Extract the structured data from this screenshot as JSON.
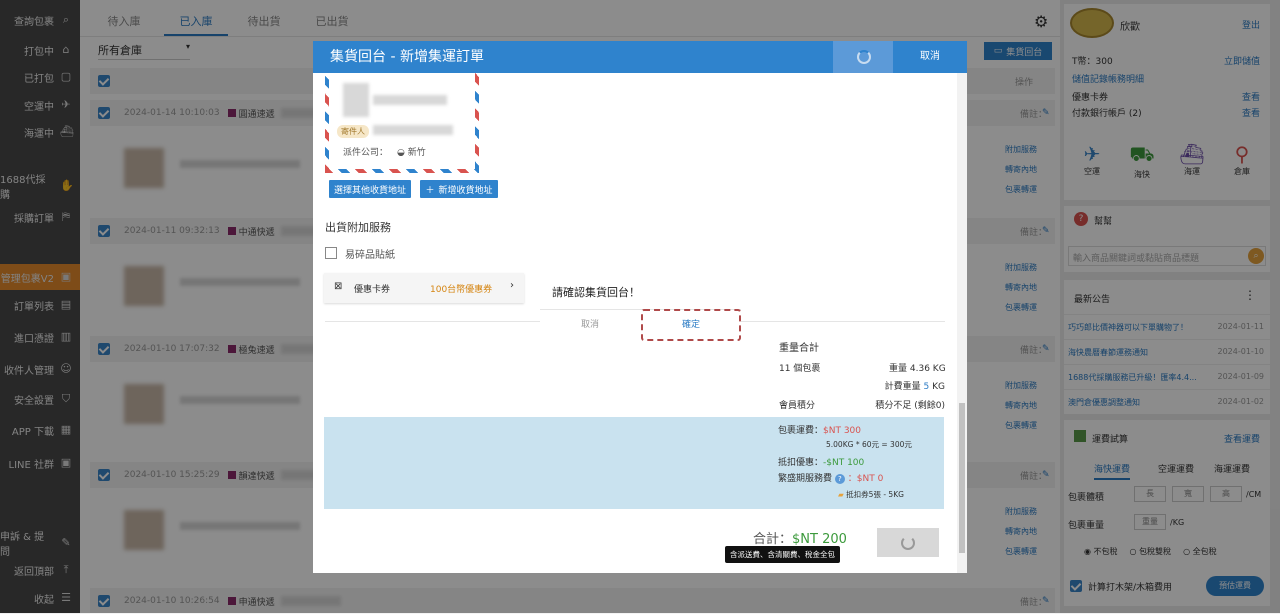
{
  "sidebar": {
    "items": [
      {
        "label": "查詢包裹",
        "icon": "search-icon",
        "glyph": "⌕"
      },
      {
        "label": "打包中",
        "icon": "gift-icon",
        "glyph": "⌂"
      },
      {
        "label": "已打包",
        "icon": "box-icon",
        "glyph": "▢"
      },
      {
        "label": "空運中",
        "icon": "plane-icon",
        "glyph": "✈"
      },
      {
        "label": "海運中",
        "icon": "ship-icon",
        "glyph": "⛴"
      },
      {
        "label": "1688代採購",
        "icon": "hand-icon",
        "glyph": "✋"
      },
      {
        "label": "採購訂單",
        "icon": "basket-icon",
        "glyph": "⛿"
      },
      {
        "label": "管理包裹V2",
        "icon": "box-icon",
        "glyph": "▣"
      },
      {
        "label": "訂單列表",
        "icon": "clipboard-icon",
        "glyph": "▤"
      },
      {
        "label": "進口憑證",
        "icon": "printer-icon",
        "glyph": "▥"
      },
      {
        "label": "收件人管理",
        "icon": "user-icon",
        "glyph": "☺"
      },
      {
        "label": "安全設置",
        "icon": "shield-icon",
        "glyph": "⛉"
      },
      {
        "label": "APP 下載",
        "icon": "bus-icon",
        "glyph": "▦"
      },
      {
        "label": "LINE 社群",
        "icon": "line-icon",
        "glyph": "▣"
      },
      {
        "label": "申訴 & 提問",
        "icon": "edit-icon",
        "glyph": "✎"
      },
      {
        "label": "返回頂部",
        "icon": "arrow-up-icon",
        "glyph": "⤒"
      },
      {
        "label": "收起",
        "icon": "collapse-icon",
        "glyph": "☰"
      }
    ]
  },
  "main": {
    "tabs": [
      "待入庫",
      "已入庫",
      "待出貨",
      "已出貨"
    ],
    "active_tab": 1,
    "warehouse_select": "所有倉庫",
    "consolidate_button": "集貨回台",
    "operation_header": "操作",
    "orders": [
      {
        "time": "2024-01-14 10:10:03",
        "carrier": "圓通速遞",
        "remark": "備註："
      },
      {
        "time": "2024-01-11 09:32:13",
        "carrier": "中通快遞",
        "remark": "備註："
      },
      {
        "time": "2024-01-10 17:07:32",
        "carrier": "極兔速遞",
        "remark": "備註："
      },
      {
        "time": "2024-01-10 15:25:29",
        "carrier": "韻達快遞",
        "remark": "備註："
      },
      {
        "time": "2024-01-10 10:26:54",
        "carrier": "申通快遞",
        "remark": "備註："
      }
    ],
    "order_links": [
      "附加服務",
      "轉寄內地",
      "包裹轉運"
    ]
  },
  "modal": {
    "title": "集貨回台 - 新增集運訂單",
    "cancel_label": "取消",
    "sender_badge": "寄件人",
    "delivery_company_label": "派件公司：",
    "delivery_company_value": "新竹",
    "choose_address_button": "選擇其他收貨地址",
    "add_address_button": "新增收貨地址",
    "extra_service_title": "出貨附加服務",
    "fragile_label": "易碎品貼紙",
    "coupon_label": "優惠卡券",
    "coupon_value": "100台幣優惠券",
    "weight_title": "重量合計",
    "package_count": "11 個包裹",
    "weight_label": "重量",
    "weight_value": "4.36 KG",
    "billing_weight_label": "計費重量",
    "billing_weight_value": "5",
    "billing_weight_unit": "KG",
    "member_points_label": "會員積分",
    "member_points_value": "積分不足 (剩餘0)",
    "shipping_fee_label": "包裹運費：",
    "shipping_fee_value": "$NT 300",
    "shipping_formula": "5.00KG * 60元 = 300元",
    "discount_label": "抵扣優惠：",
    "discount_value": "-$NT 100",
    "surge_fee_label": "繁盛期服務費",
    "surge_fee_value": "：$NT 0",
    "coupon_note": "抵扣券5張 - 5KG",
    "total_label": "合計：",
    "total_value": "$NT 200",
    "tax_note": "含派送費、含清關費、稅金全包"
  },
  "confirm_dialog": {
    "message": "請確認集貨回台！",
    "cancel_label": "取消",
    "ok_label": "確定"
  },
  "right_panel": {
    "username": "欣歡",
    "logout": "登出",
    "balance_label": "T幣：300",
    "recharge": "立即儲值",
    "record_link": "儲值記錄",
    "detail_link": "帳務明細",
    "coupon_label": "優惠卡券",
    "coupon_link": "查看",
    "bank_label": "付款銀行帳戶 (2)",
    "bank_link": "查看",
    "transport_modes": [
      "空運",
      "海快",
      "海運",
      "倉庫"
    ],
    "help_title": "幫幫",
    "search_placeholder": "輸入商品關鍵詞或黏貼商品標題",
    "announcements_title": "最新公告",
    "announcements": [
      {
        "title": "巧巧郎比價神器可以下單購物了！",
        "date": "2024-01-11"
      },
      {
        "title": "海快農曆春節運務通知",
        "date": "2024-01-10"
      },
      {
        "title": "1688代採購服務已升級！匯率4.4...",
        "date": "2024-01-09"
      },
      {
        "title": "澳門倉優惠調整通知",
        "date": "2024-01-02"
      }
    ],
    "calc_title": "運費試算",
    "calc_link": "查看運費",
    "calc_tabs": [
      "海快運費",
      "空運運費",
      "海運運費"
    ],
    "size_label": "包裹體積",
    "size_fields": [
      "長",
      "寬",
      "高"
    ],
    "size_unit": "/CM",
    "weight_label": "包裹重量",
    "weight_field": "重量",
    "weight_unit": "/KG",
    "tax_options": [
      "不包稅",
      "包稅雙稅",
      "全包稅"
    ],
    "wood_label": "計算打木架/木箱費用",
    "estimate_button": "預估運費"
  }
}
